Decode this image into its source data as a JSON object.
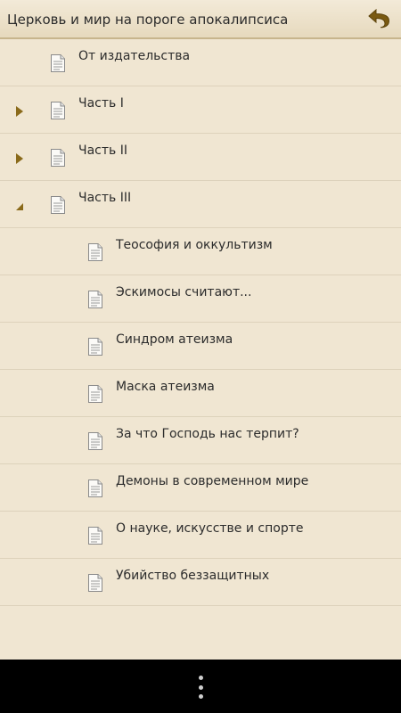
{
  "header": {
    "title": "Церковь и мир на пороге апокалипсиса",
    "back_icon": "undo-arrow-icon"
  },
  "colors": {
    "background": "#f0e6d2",
    "accent": "#7a5a12",
    "divider": "#ddd2bb"
  },
  "items": [
    {
      "label": "От издательства",
      "level": 0,
      "toggle": "none"
    },
    {
      "label": "Часть I",
      "level": 0,
      "toggle": "collapsed"
    },
    {
      "label": "Часть II",
      "level": 0,
      "toggle": "collapsed"
    },
    {
      "label": "Часть III",
      "level": 0,
      "toggle": "expanded"
    },
    {
      "label": "Теософия и оккультизм",
      "level": 1,
      "toggle": "none"
    },
    {
      "label": "Эскимосы считают...",
      "level": 1,
      "toggle": "none"
    },
    {
      "label": "Синдром атеизма",
      "level": 1,
      "toggle": "none"
    },
    {
      "label": "Маска атеизма",
      "level": 1,
      "toggle": "none"
    },
    {
      "label": "За что Господь нас терпит?",
      "level": 1,
      "toggle": "none"
    },
    {
      "label": "Демоны в современном мире",
      "level": 1,
      "toggle": "none"
    },
    {
      "label": "О науке, искусстве и спорте",
      "level": 1,
      "toggle": "none"
    },
    {
      "label": "Убийство беззащитных",
      "level": 1,
      "toggle": "none"
    }
  ],
  "nav": {
    "menu_icon": "overflow-menu-icon"
  }
}
